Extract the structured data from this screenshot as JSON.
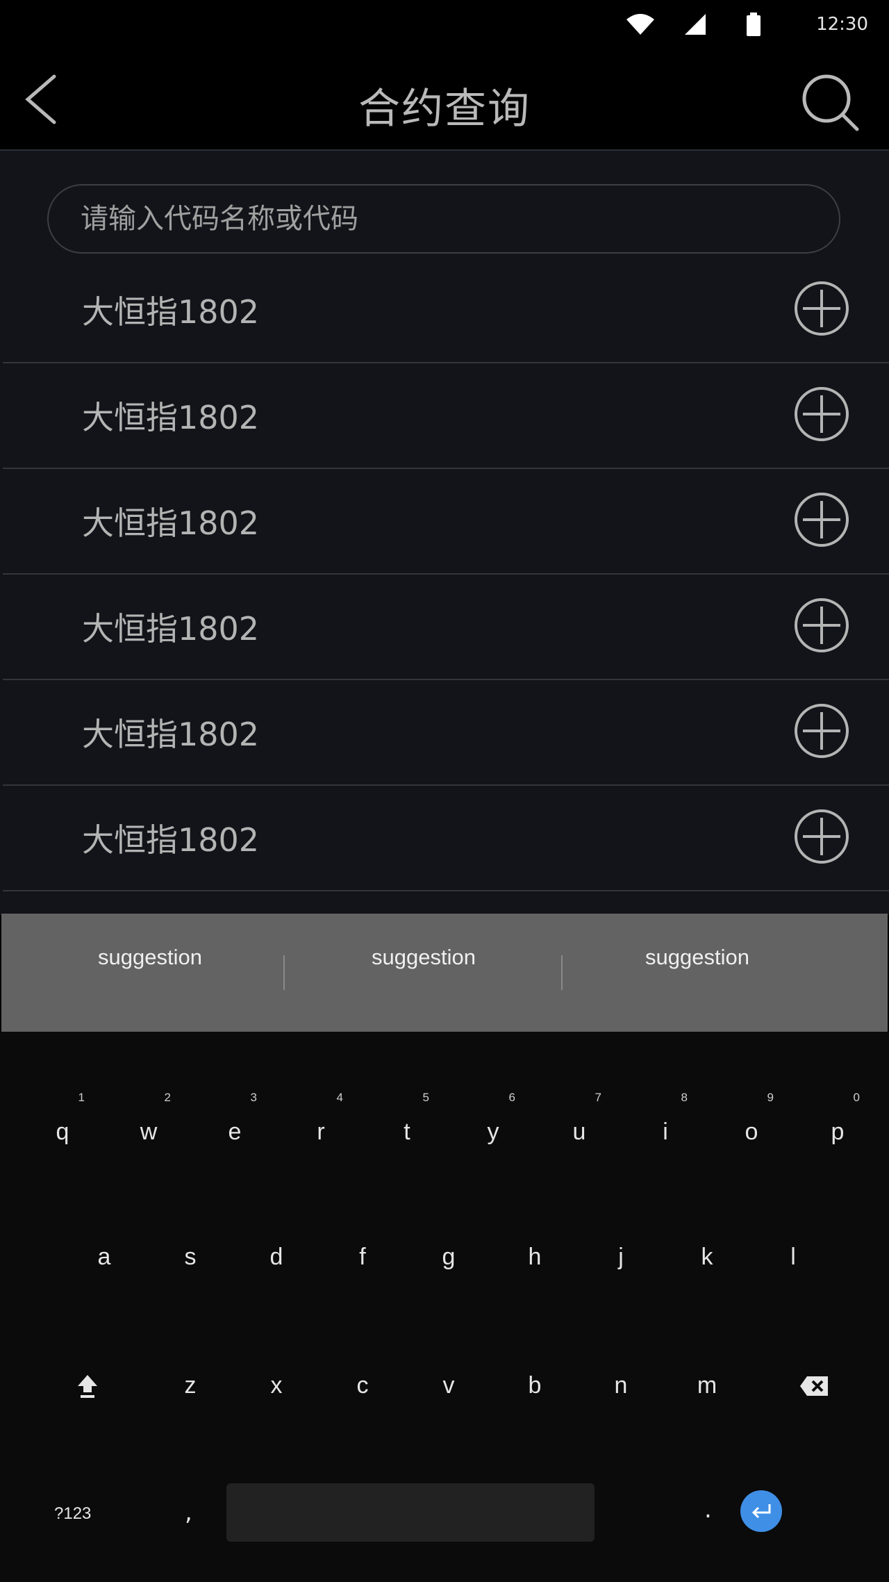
{
  "status_bar": {
    "time": "12:30"
  },
  "header": {
    "title": "合约查询"
  },
  "search": {
    "placeholder": "请输入代码名称或代码",
    "value": ""
  },
  "list": [
    {
      "label": "大恒指1802"
    },
    {
      "label": "大恒指1802"
    },
    {
      "label": "大恒指1802"
    },
    {
      "label": "大恒指1802"
    },
    {
      "label": "大恒指1802"
    },
    {
      "label": "大恒指1802"
    }
  ],
  "keyboard": {
    "suggestions": [
      "suggestion",
      "suggestion",
      "suggestion"
    ],
    "row1": [
      {
        "char": "q",
        "hint": "1"
      },
      {
        "char": "w",
        "hint": "2"
      },
      {
        "char": "e",
        "hint": "3"
      },
      {
        "char": "r",
        "hint": "4"
      },
      {
        "char": "t",
        "hint": "5"
      },
      {
        "char": "y",
        "hint": "6"
      },
      {
        "char": "u",
        "hint": "7"
      },
      {
        "char": "i",
        "hint": "8"
      },
      {
        "char": "o",
        "hint": "9"
      },
      {
        "char": "p",
        "hint": "0"
      }
    ],
    "row2": [
      "a",
      "s",
      "d",
      "f",
      "g",
      "h",
      "j",
      "k",
      "l"
    ],
    "row3": [
      "z",
      "x",
      "c",
      "v",
      "b",
      "n",
      "m"
    ],
    "symbols_label": "?123",
    "comma": ",",
    "period": "."
  },
  "icons": {
    "back": "chevron-left-icon",
    "search": "search-icon",
    "add": "plus-circle-icon",
    "shift": "shift-icon",
    "backspace": "backspace-icon",
    "enter": "enter-icon"
  },
  "colors": {
    "background": "#121419",
    "header": "#000000",
    "text": "#b4b4b4",
    "divider": "#32353c",
    "suggestion_bar": "#636363",
    "enter_key": "#3f8fe6"
  }
}
